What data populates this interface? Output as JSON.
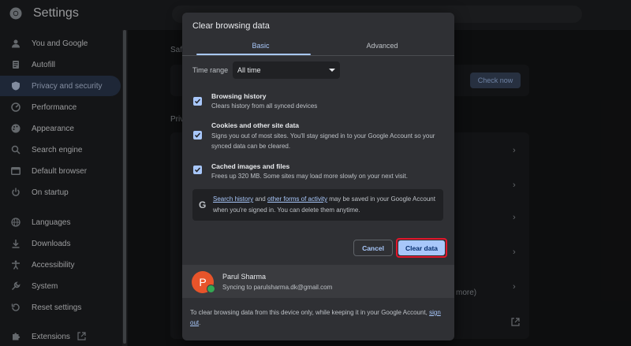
{
  "app": {
    "title": "Settings"
  },
  "sidebar": {
    "items": [
      {
        "label": "You and Google",
        "icon": "person-icon"
      },
      {
        "label": "Autofill",
        "icon": "autofill-icon"
      },
      {
        "label": "Privacy and security",
        "icon": "shield-icon",
        "active": true
      },
      {
        "label": "Performance",
        "icon": "speedometer-icon"
      },
      {
        "label": "Appearance",
        "icon": "palette-icon"
      },
      {
        "label": "Search engine",
        "icon": "search-icon"
      },
      {
        "label": "Default browser",
        "icon": "browser-icon"
      },
      {
        "label": "On startup",
        "icon": "power-icon"
      },
      {
        "label": "Languages",
        "icon": "globe-icon"
      },
      {
        "label": "Downloads",
        "icon": "download-icon"
      },
      {
        "label": "Accessibility",
        "icon": "accessibility-icon"
      },
      {
        "label": "System",
        "icon": "wrench-icon"
      },
      {
        "label": "Reset settings",
        "icon": "reset-icon"
      },
      {
        "label": "Extensions",
        "icon": "puzzle-icon"
      }
    ]
  },
  "background": {
    "section_safety": "Saf",
    "section_privacy": "Priv",
    "check_now": "Check now",
    "partial_more": "more)"
  },
  "dialog": {
    "title": "Clear browsing data",
    "tabs": {
      "basic": "Basic",
      "advanced": "Advanced"
    },
    "time_range": {
      "label": "Time range",
      "value": "All time"
    },
    "options": [
      {
        "title": "Browsing history",
        "desc": "Clears history from all synced devices",
        "checked": true
      },
      {
        "title": "Cookies and other site data",
        "desc": "Signs you out of most sites. You'll stay signed in to your Google Account so your synced data can be cleared.",
        "checked": true
      },
      {
        "title": "Cached images and files",
        "desc": "Frees up 320 MB. Some sites may load more slowly on your next visit.",
        "checked": true
      }
    ],
    "info": {
      "link1": "Search history",
      "and": " and ",
      "link2": "other forms of activity",
      "rest": " may be saved in your Google Account when you're signed in. You can delete them anytime."
    },
    "buttons": {
      "cancel": "Cancel",
      "clear": "Clear data"
    },
    "account": {
      "initial": "P",
      "name": "Parul Sharma",
      "sync": "Syncing to parulsharma.dk@gmail.com"
    },
    "footer": {
      "text": "To clear browsing data from this device only, while keeping it in your Google Account, ",
      "link": "sign out",
      "end": "."
    }
  },
  "colors": {
    "accent": "#a8c7fa",
    "highlight_outline": "#e0162b",
    "avatar": "#e8542a",
    "sync_badge": "#34a853"
  }
}
